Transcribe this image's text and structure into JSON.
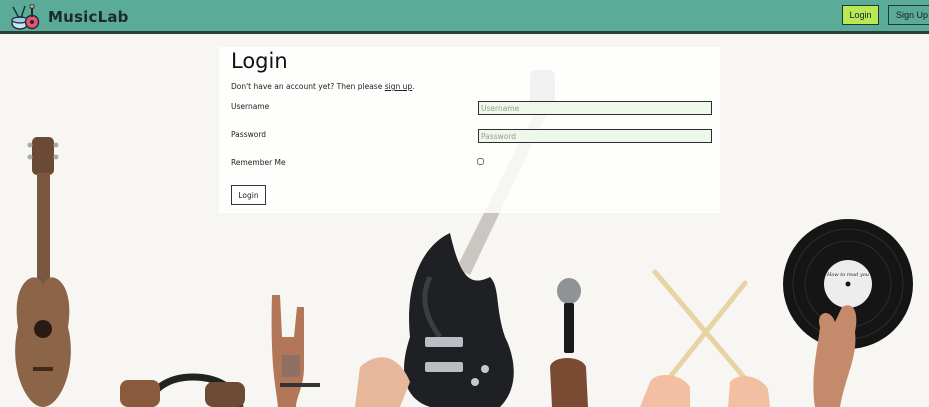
{
  "navbar": {
    "brand": "MusicLab",
    "login_label": "Login",
    "signup_label": "Sign Up"
  },
  "login_form": {
    "title": "Login",
    "subtitle_text": "Don't have an account yet? Then please ",
    "subtitle_link": "sign up",
    "subtitle_end": ".",
    "username_label": "Username",
    "username_placeholder": "Username",
    "password_label": "Password",
    "password_placeholder": "Password",
    "remember_label": "Remember Me",
    "remember_checked": false,
    "submit_label": "Login"
  },
  "vinyl_label": "How to read you",
  "colors": {
    "navbar_bg": "#5aab98",
    "login_button_bg": "#b8ea57",
    "input_bg": "#eef8e8",
    "page_bg": "#f7f6f3"
  },
  "icons": {
    "brand_logo": "music-logo-icon"
  }
}
